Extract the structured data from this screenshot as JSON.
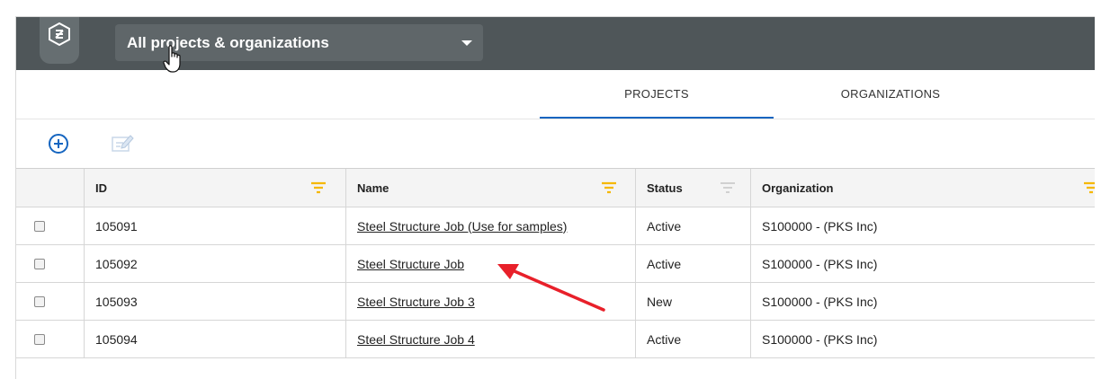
{
  "header": {
    "project_selector": "All projects & organizations"
  },
  "tabs": [
    {
      "label": "PROJECTS",
      "active": true
    },
    {
      "label": "ORGANIZATIONS",
      "active": false
    }
  ],
  "toolbar": {
    "add_icon": "plus-circle-icon",
    "edit_icon": "edit-icon"
  },
  "table": {
    "columns": [
      "ID",
      "Name",
      "Status",
      "Organization"
    ],
    "rows": [
      {
        "id": "105091",
        "name": "Steel Structure Job (Use for samples)",
        "status": "Active",
        "organization": "S100000 - (PKS Inc)"
      },
      {
        "id": "105092",
        "name": "Steel Structure Job",
        "status": "Active",
        "organization": "S100000 - (PKS Inc)"
      },
      {
        "id": "105093",
        "name": "Steel Structure Job 3",
        "status": "New",
        "organization": "S100000 - (PKS Inc)"
      },
      {
        "id": "105094",
        "name": "Steel Structure Job 4",
        "status": "Active",
        "organization": "S100000 - (PKS Inc)"
      }
    ]
  },
  "colors": {
    "topbar": "#4f5659",
    "accent": "#1565c0",
    "filter_active": "#f5b800",
    "annotation_arrow": "#e8202a"
  }
}
